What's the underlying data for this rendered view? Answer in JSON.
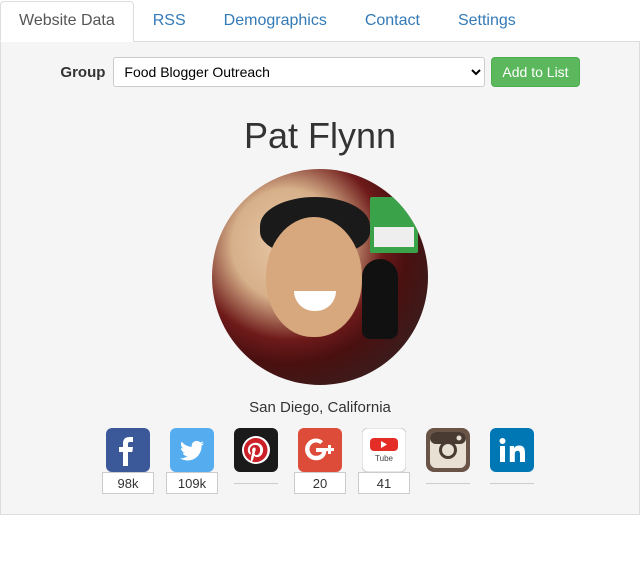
{
  "tabs": [
    {
      "label": "Website Data",
      "active": true
    },
    {
      "label": "RSS",
      "active": false
    },
    {
      "label": "Demographics",
      "active": false
    },
    {
      "label": "Contact",
      "active": false
    },
    {
      "label": "Settings",
      "active": false
    }
  ],
  "group": {
    "label": "Group",
    "selected": "Food Blogger Outreach",
    "add_button": "Add to List"
  },
  "profile": {
    "name": "Pat Flynn",
    "location": "San Diego, California"
  },
  "socials": [
    {
      "name": "facebook",
      "count": "98k"
    },
    {
      "name": "twitter",
      "count": "109k"
    },
    {
      "name": "pinterest",
      "count": ""
    },
    {
      "name": "googleplus",
      "count": "20"
    },
    {
      "name": "youtube",
      "count": "41"
    },
    {
      "name": "instagram",
      "count": ""
    },
    {
      "name": "linkedin",
      "count": ""
    }
  ]
}
